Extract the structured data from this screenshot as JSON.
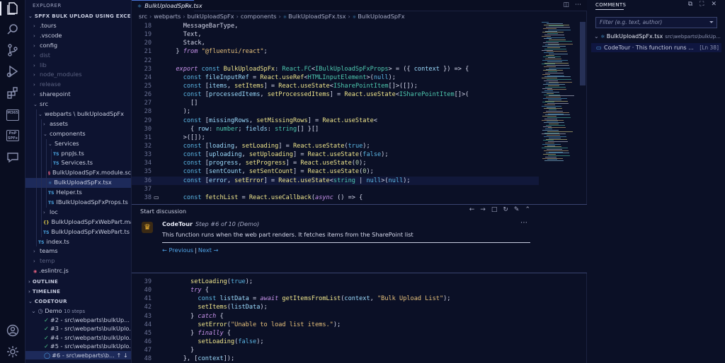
{
  "sidebar": {
    "title": "EXPLORER",
    "project": "SPFX BULK UPLOAD USING EXCEL",
    "tree": [
      {
        "label": ".tours",
        "chev": "›",
        "indent": 1,
        "dim": false
      },
      {
        "label": ".vscode",
        "chev": "›",
        "indent": 1,
        "dim": false
      },
      {
        "label": "config",
        "chev": "›",
        "indent": 1,
        "dim": false
      },
      {
        "label": "dist",
        "chev": "›",
        "indent": 1,
        "dim": true
      },
      {
        "label": "lib",
        "chev": "›",
        "indent": 1,
        "dim": true
      },
      {
        "label": "node_modules",
        "chev": "›",
        "indent": 1,
        "dim": true
      },
      {
        "label": "release",
        "chev": "›",
        "indent": 1,
        "dim": true
      },
      {
        "label": "sharepoint",
        "chev": "›",
        "indent": 1,
        "dim": false
      },
      {
        "label": "src",
        "chev": "⌄",
        "indent": 1,
        "dim": false
      },
      {
        "label": "webparts \\ bulkUploadSpFx",
        "chev": "⌄",
        "indent": 2,
        "dim": false
      },
      {
        "label": "assets",
        "chev": "›",
        "indent": 3,
        "dim": false
      },
      {
        "label": "components",
        "chev": "⌄",
        "indent": 3,
        "dim": false
      },
      {
        "label": "Services",
        "chev": "⌄",
        "indent": 4,
        "dim": false
      },
      {
        "label": "pnpJs.ts",
        "icon": "TS",
        "iconClass": "ts",
        "indent": 5,
        "dim": false
      },
      {
        "label": "Services.ts",
        "icon": "TS",
        "iconClass": "ts",
        "indent": 5,
        "dim": false
      },
      {
        "label": "BulkUploadSpFx.module.scss",
        "icon": "§",
        "iconClass": "scss",
        "indent": 4,
        "dim": false
      },
      {
        "label": "BulkUploadSpFx.tsx",
        "icon": "⚛",
        "iconClass": "ts",
        "indent": 4,
        "dim": false,
        "selected": true
      },
      {
        "label": "Helper.ts",
        "icon": "TS",
        "iconClass": "ts",
        "indent": 4,
        "dim": false
      },
      {
        "label": "IBulkUploadSpFxProps.ts",
        "icon": "TS",
        "iconClass": "ts",
        "indent": 4,
        "dim": false
      },
      {
        "label": "loc",
        "chev": "›",
        "indent": 3,
        "dim": false
      },
      {
        "label": "BulkUploadSpFxWebPart.manif...",
        "icon": "{}",
        "iconClass": "js",
        "indent": 3,
        "dim": false
      },
      {
        "label": "BulkUploadSpFxWebPart.ts",
        "icon": "TS",
        "iconClass": "ts",
        "indent": 3,
        "dim": false
      },
      {
        "label": "index.ts",
        "icon": "TS",
        "iconClass": "ts",
        "indent": 2,
        "dim": false
      },
      {
        "label": "teams",
        "chev": "›",
        "indent": 1,
        "dim": false
      },
      {
        "label": "temp",
        "chev": "›",
        "indent": 1,
        "dim": true
      },
      {
        "label": ".eslintrc.js",
        "icon": "◉",
        "iconClass": "scss",
        "indent": 1,
        "dim": false
      }
    ],
    "outline": "OUTLINE",
    "timeline": "TIMELINE",
    "codetour": "CODETOUR",
    "tour_name": "Demo",
    "tour_steps": "10 steps",
    "tour_items": [
      "#2 - src\\webparts\\bulkUp...",
      "#3 - src\\webparts\\bulkUplo...",
      "#4 - src\\webparts\\bulkUplo...",
      "#5 - src\\webparts\\bulkUplo...",
      "#6 - src\\webparts\\b..."
    ]
  },
  "editor": {
    "tab_label": "BulkUploadSpFx.tsx",
    "breadcrumb": [
      "src",
      "webparts",
      "bulkUploadSpFx",
      "components",
      "BulkUploadSpFx.tsx",
      "BulkUploadSpFx"
    ],
    "code_top": [
      {
        "n": "18",
        "t": [
          [
            "plain",
            "    MessageBarType,"
          ]
        ]
      },
      {
        "n": "19",
        "t": [
          [
            "plain",
            "    Text,"
          ]
        ]
      },
      {
        "n": "20",
        "t": [
          [
            "plain",
            "    Stack,"
          ]
        ]
      },
      {
        "n": "21",
        "t": [
          [
            "plain",
            "  } "
          ],
          [
            "kw2",
            "from"
          ],
          [
            "str",
            " \"@fluentui/react\""
          ],
          [
            "plain",
            ";"
          ]
        ]
      },
      {
        "n": "22",
        "t": [
          [
            "plain",
            ""
          ]
        ]
      },
      {
        "n": "23",
        "t": [
          [
            "kw2",
            "  export"
          ],
          [
            "kw",
            " const"
          ],
          [
            "fn",
            " BulkUploadSpFx"
          ],
          [
            "plain",
            ": "
          ],
          [
            "ty",
            "React.FC"
          ],
          [
            "plain",
            "<"
          ],
          [
            "ty",
            "IBulkUploadSpFxProps"
          ],
          [
            "plain",
            "> = ({ "
          ],
          [
            "var",
            "context"
          ],
          [
            "plain",
            " }) => {"
          ]
        ]
      },
      {
        "n": "24",
        "t": [
          [
            "kw",
            "    const"
          ],
          [
            "var",
            " fileInputRef"
          ],
          [
            "plain",
            " = "
          ],
          [
            "fn",
            "React.useRef"
          ],
          [
            "plain",
            "<"
          ],
          [
            "ty",
            "HTMLInputElement"
          ],
          [
            "plain",
            ">("
          ],
          [
            "kw",
            "null"
          ],
          [
            "plain",
            ");"
          ]
        ]
      },
      {
        "n": "25",
        "t": [
          [
            "kw",
            "    const"
          ],
          [
            "plain",
            " ["
          ],
          [
            "var",
            "items"
          ],
          [
            "plain",
            ", "
          ],
          [
            "fn",
            "setItems"
          ],
          [
            "plain",
            "] = "
          ],
          [
            "fn",
            "React.useState"
          ],
          [
            "plain",
            "<"
          ],
          [
            "ty",
            "ISharePointItem"
          ],
          [
            "plain",
            "[]>([]);"
          ]
        ]
      },
      {
        "n": "26",
        "t": [
          [
            "kw",
            "    const"
          ],
          [
            "plain",
            " ["
          ],
          [
            "var",
            "processedItems"
          ],
          [
            "plain",
            ", "
          ],
          [
            "fn",
            "setProcessedItems"
          ],
          [
            "plain",
            "] = "
          ],
          [
            "fn",
            "React.useState"
          ],
          [
            "plain",
            "<"
          ],
          [
            "ty",
            "ISharePointItem"
          ],
          [
            "plain",
            "[]>("
          ]
        ]
      },
      {
        "n": "27",
        "t": [
          [
            "plain",
            "      []"
          ]
        ]
      },
      {
        "n": "28",
        "t": [
          [
            "plain",
            "    );"
          ]
        ]
      },
      {
        "n": "29",
        "t": [
          [
            "kw",
            "    const"
          ],
          [
            "plain",
            " ["
          ],
          [
            "var",
            "missingRows"
          ],
          [
            "plain",
            ", "
          ],
          [
            "fn",
            "setMissingRows"
          ],
          [
            "plain",
            "] = "
          ],
          [
            "fn",
            "React.useState"
          ],
          [
            "plain",
            "<"
          ]
        ]
      },
      {
        "n": "30",
        "t": [
          [
            "plain",
            "      { "
          ],
          [
            "var",
            "row"
          ],
          [
            "plain",
            ": "
          ],
          [
            "ty",
            "number"
          ],
          [
            "plain",
            "; "
          ],
          [
            "var",
            "fields"
          ],
          [
            "plain",
            ": "
          ],
          [
            "ty",
            "string"
          ],
          [
            "plain",
            "[] }[]"
          ]
        ]
      },
      {
        "n": "31",
        "t": [
          [
            "plain",
            "    >([]);"
          ]
        ]
      },
      {
        "n": "32",
        "t": [
          [
            "kw",
            "    const"
          ],
          [
            "plain",
            " ["
          ],
          [
            "var",
            "loading"
          ],
          [
            "plain",
            ", "
          ],
          [
            "fn",
            "setLoading"
          ],
          [
            "plain",
            "] = "
          ],
          [
            "fn",
            "React.useState"
          ],
          [
            "plain",
            "("
          ],
          [
            "kw",
            "true"
          ],
          [
            "plain",
            ");"
          ]
        ]
      },
      {
        "n": "33",
        "t": [
          [
            "kw",
            "    const"
          ],
          [
            "plain",
            " ["
          ],
          [
            "var",
            "uploading"
          ],
          [
            "plain",
            ", "
          ],
          [
            "fn",
            "setUploading"
          ],
          [
            "plain",
            "] = "
          ],
          [
            "fn",
            "React.useState"
          ],
          [
            "plain",
            "("
          ],
          [
            "kw",
            "false"
          ],
          [
            "plain",
            ");"
          ]
        ]
      },
      {
        "n": "34",
        "t": [
          [
            "kw",
            "    const"
          ],
          [
            "plain",
            " ["
          ],
          [
            "var",
            "progress"
          ],
          [
            "plain",
            ", "
          ],
          [
            "fn",
            "setProgress"
          ],
          [
            "plain",
            "] = "
          ],
          [
            "fn",
            "React.useState"
          ],
          [
            "plain",
            "("
          ],
          [
            "num",
            "0"
          ],
          [
            "plain",
            ");"
          ]
        ]
      },
      {
        "n": "35",
        "t": [
          [
            "kw",
            "    const"
          ],
          [
            "plain",
            " ["
          ],
          [
            "var",
            "sentCount"
          ],
          [
            "plain",
            ", "
          ],
          [
            "fn",
            "setSentCount"
          ],
          [
            "plain",
            "] = "
          ],
          [
            "fn",
            "React.useState"
          ],
          [
            "plain",
            "("
          ],
          [
            "num",
            "0"
          ],
          [
            "plain",
            ");"
          ]
        ]
      },
      {
        "n": "36",
        "t": [
          [
            "kw",
            "    const"
          ],
          [
            "plain",
            " ["
          ],
          [
            "var",
            "error"
          ],
          [
            "plain",
            ", "
          ],
          [
            "fn",
            "setError"
          ],
          [
            "plain",
            "] = "
          ],
          [
            "fn",
            "React.useState"
          ],
          [
            "plain",
            "<"
          ],
          [
            "ty",
            "string"
          ],
          [
            "plain",
            " | "
          ],
          [
            "kw",
            "null"
          ],
          [
            "plain",
            ">("
          ],
          [
            "kw",
            "null"
          ],
          [
            "plain",
            ");"
          ]
        ]
      },
      {
        "n": "37",
        "t": [
          [
            "plain",
            ""
          ]
        ]
      },
      {
        "n": "38",
        "t": [
          [
            "kw",
            "    const"
          ],
          [
            "fn",
            " fetchList"
          ],
          [
            "plain",
            " = "
          ],
          [
            "fn",
            "React.useCallback"
          ],
          [
            "plain",
            "("
          ],
          [
            "kw2",
            "async"
          ],
          [
            "plain",
            " () => {"
          ]
        ],
        "comment": true
      }
    ],
    "code_bottom": [
      {
        "n": "39",
        "t": [
          [
            "fn",
            "      setLoading"
          ],
          [
            "plain",
            "("
          ],
          [
            "kw",
            "true"
          ],
          [
            "plain",
            ");"
          ]
        ]
      },
      {
        "n": "40",
        "t": [
          [
            "kw2",
            "      try"
          ],
          [
            "plain",
            " {"
          ]
        ]
      },
      {
        "n": "41",
        "t": [
          [
            "kw",
            "        const"
          ],
          [
            "var",
            " listData"
          ],
          [
            "plain",
            " = "
          ],
          [
            "kw2",
            "await"
          ],
          [
            "fn",
            " getItemsFromList"
          ],
          [
            "plain",
            "("
          ],
          [
            "var",
            "context"
          ],
          [
            "plain",
            ", "
          ],
          [
            "str",
            "\"Bulk Upload List\""
          ],
          [
            "plain",
            ");"
          ]
        ]
      },
      {
        "n": "42",
        "t": [
          [
            "fn",
            "        setItems"
          ],
          [
            "plain",
            "("
          ],
          [
            "var",
            "listData"
          ],
          [
            "plain",
            ");"
          ]
        ]
      },
      {
        "n": "43",
        "t": [
          [
            "plain",
            "      } "
          ],
          [
            "kw2",
            "catch"
          ],
          [
            "plain",
            " {"
          ]
        ]
      },
      {
        "n": "44",
        "t": [
          [
            "fn",
            "        setError"
          ],
          [
            "plain",
            "("
          ],
          [
            "str",
            "\"Unable to load list items.\""
          ],
          [
            "plain",
            ");"
          ]
        ]
      },
      {
        "n": "45",
        "t": [
          [
            "plain",
            "      } "
          ],
          [
            "kw2",
            "finally"
          ],
          [
            "plain",
            " {"
          ]
        ]
      },
      {
        "n": "46",
        "t": [
          [
            "fn",
            "        setLoading"
          ],
          [
            "plain",
            "("
          ],
          [
            "kw",
            "false"
          ],
          [
            "plain",
            ");"
          ]
        ]
      },
      {
        "n": "47",
        "t": [
          [
            "plain",
            "      }"
          ]
        ]
      },
      {
        "n": "48",
        "t": [
          [
            "plain",
            "    }, ["
          ],
          [
            "var",
            "context"
          ],
          [
            "plain",
            "]);"
          ]
        ]
      }
    ]
  },
  "discussion": {
    "header": "Start discussion",
    "author": "CodeTour",
    "step": "Step #6 of 10 (Demo)",
    "body": "This function runs when the web part renders. It fetches items from the SharePoint list",
    "prev": "← Previous",
    "next": "Next →"
  },
  "comments": {
    "tab_label": "COMMENTS",
    "filter_placeholder": "Filter (e.g. text, author)",
    "file": "BulkUploadSpFx.tsx",
    "file_path": "src\\webparts\\bulkUp...",
    "entry_text": "CodeTour · This function runs ...",
    "entry_pos": "[Ln 38]"
  },
  "colors": {
    "background": "#0b1026",
    "accent": "#4a74d9",
    "link": "#4fa3e6"
  },
  "icons": {
    "activity": [
      "explorer-icon",
      "search-icon",
      "source-control-icon",
      "run-debug-icon",
      "extensions-icon",
      "m365-icon",
      "pnp-spfx-icon",
      "comments-icon",
      "account-icon",
      "manage-gear-icon"
    ]
  }
}
